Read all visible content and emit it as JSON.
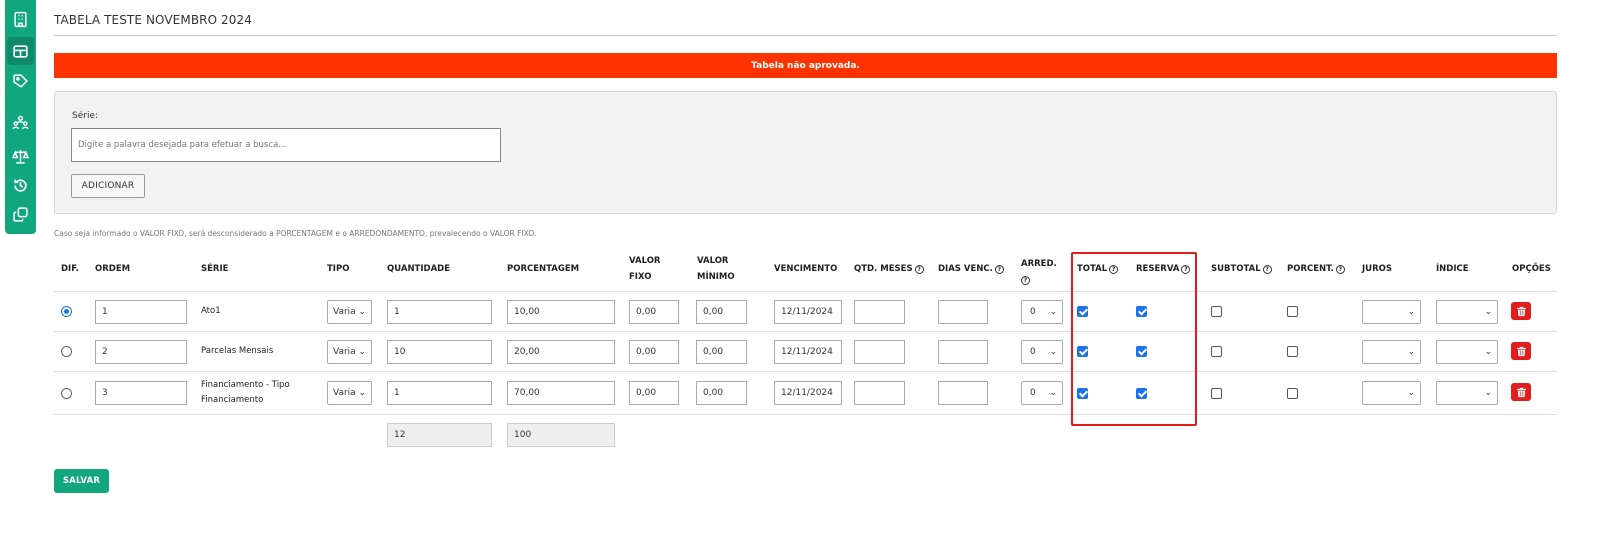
{
  "page": {
    "title": "TABELA TESTE NOVEMBRO 2024",
    "alert": "Tabela não aprovada.",
    "note": "Caso seja informado o VALOR FIXO, será desconsiderado a PORCENTAGEM e o ARREDONDAMENTO, prevalecendo o VALOR FIXO.",
    "save_label": "SALVAR"
  },
  "sidebar": {
    "items": [
      {
        "icon": "building-icon"
      },
      {
        "icon": "table-icon",
        "active": true
      },
      {
        "icon": "tag-icon"
      },
      {
        "icon": "users-icon"
      },
      {
        "icon": "scale-icon"
      },
      {
        "icon": "history-icon"
      },
      {
        "icon": "copy-icon"
      }
    ]
  },
  "filter": {
    "serie_label": "Série:",
    "search_placeholder": "Digite a palavra desejada para efetuar a busca...",
    "add_label": "ADICIONAR"
  },
  "table": {
    "headers": {
      "dif": "DIF.",
      "ordem": "ORDEM",
      "serie": "SÉRIE",
      "tipo": "TIPO",
      "quantidade": "QUANTIDADE",
      "porcentagem": "PORCENTAGEM",
      "valor_fixo_1": "VALOR",
      "valor_fixo_2": "FIXO",
      "valor_minimo_1": "VALOR",
      "valor_minimo_2": "MÍNIMO",
      "vencimento": "VENCIMENTO",
      "qtd_meses": "QTD. MESES",
      "dias_venc": "DIAS VENC.",
      "arred": "ARRED.",
      "total": "TOTAL",
      "reserva": "RESERVA",
      "subtotal": "SUBTOTAL",
      "porcent": "PORCENT.",
      "juros": "JUROS",
      "indice": "ÍNDICE",
      "opcoes": "OPÇÕES"
    },
    "rows": [
      {
        "dif_selected": true,
        "ordem": "1",
        "serie_line1": "Ato1",
        "serie_line2": "",
        "tipo": "Varia",
        "quantidade": "1",
        "porcentagem": "10,00",
        "valor_fixo": "0,00",
        "valor_minimo": "0,00",
        "vencimento": "12/11/2024",
        "qtd_meses": "",
        "dias_venc": "",
        "arred": "0",
        "total": true,
        "reserva": true,
        "subtotal": false,
        "porcent": false,
        "juros": "",
        "indice": ""
      },
      {
        "dif_selected": false,
        "ordem": "2",
        "serie_line1": "Parcelas Mensais",
        "serie_line2": "",
        "tipo": "Varia",
        "quantidade": "10",
        "porcentagem": "20,00",
        "valor_fixo": "0,00",
        "valor_minimo": "0,00",
        "vencimento": "12/11/2024",
        "qtd_meses": "",
        "dias_venc": "",
        "arred": "0",
        "total": true,
        "reserva": true,
        "subtotal": false,
        "porcent": false,
        "juros": "",
        "indice": ""
      },
      {
        "dif_selected": false,
        "ordem": "3",
        "serie_line1": "Financiamento - Tipo",
        "serie_line2": "Financiamento",
        "tipo": "Varia",
        "quantidade": "1",
        "porcentagem": "70,00",
        "valor_fixo": "0,00",
        "valor_minimo": "0,00",
        "vencimento": "12/11/2024",
        "qtd_meses": "",
        "dias_venc": "",
        "arred": "0",
        "total": true,
        "reserva": true,
        "subtotal": false,
        "porcent": false,
        "juros": "",
        "indice": ""
      }
    ],
    "totals": {
      "quantidade": "12",
      "porcentagem": "100"
    }
  },
  "colors": {
    "brand": "#12a67f",
    "alert": "#ff3300",
    "delete": "#e11d1d",
    "highlight": "#e21b1b",
    "checkbox": "#1a73e8"
  }
}
